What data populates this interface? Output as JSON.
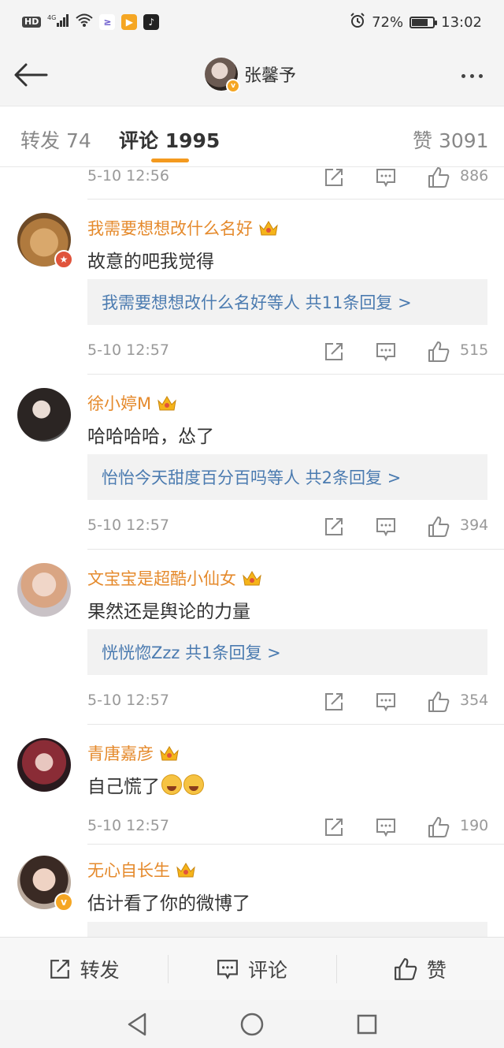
{
  "status_bar": {
    "hd_label": "HD",
    "network_label": "4G",
    "battery_text": "72%",
    "battery_level": 0.72,
    "time": "13:02"
  },
  "header": {
    "back_icon": "back-arrow-icon",
    "title": "张馨予",
    "more_icon": "more-dots-icon"
  },
  "tabs": [
    {
      "label": "转发 74",
      "active": false
    },
    {
      "label": "评论 1995",
      "active": true
    },
    {
      "label": "赞 3091",
      "active": false
    }
  ],
  "partial_row": {
    "time": "5-10 12:56",
    "likes": "886"
  },
  "comments": [
    {
      "user": "我需要想想改什么名好",
      "text": "故意的吧我觉得",
      "reply": "我需要想想改什么名好等人 共11条回复 >",
      "time": "5-10 12:57",
      "likes": "515"
    },
    {
      "user": "徐小婷M",
      "text": "哈哈哈哈，怂了",
      "reply": "怡怡今天甜度百分百吗等人 共2条回复 >",
      "time": "5-10 12:57",
      "likes": "394"
    },
    {
      "user": "文宝宝是超酷小仙女",
      "text": "果然还是舆论的力量",
      "reply": "恍恍惚Zzz 共1条回复 >",
      "time": "5-10 12:57",
      "likes": "354"
    },
    {
      "user": "青唐嘉彦",
      "text": "自己慌了",
      "time": "5-10 12:57",
      "likes": "190"
    },
    {
      "user": "无心自长生",
      "text": "估计看了你的微博了"
    }
  ],
  "bottom_bar": {
    "repost_label": "转发",
    "comment_label": "评论",
    "like_label": "赞"
  },
  "colors": {
    "username": "#e58a2c",
    "reply_link": "#4b7bb0",
    "tab_indicator": "#f49a1f",
    "verified_badge": "#f5a623"
  }
}
